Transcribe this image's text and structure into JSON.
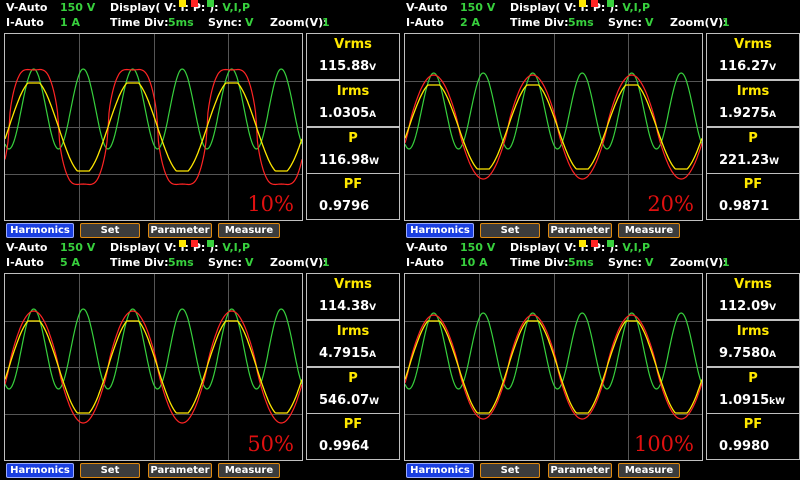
{
  "panels": [
    {
      "v_range_label": "V-Auto",
      "v_range_value": "150 V",
      "i_range_label": "I-Auto",
      "i_range_value": "1 A",
      "display_label": "Display( V:",
      "display_i": "I:",
      "display_p": "P:",
      "display_close": "):",
      "display_value": "V,I,P",
      "timediv_label": "Time  Div:",
      "timediv_value": "5ms",
      "sync_label": "Sync:",
      "sync_value": "V",
      "zoom_label": "Zoom(V):",
      "zoom_value": "1",
      "load_percent": "10%",
      "readings": [
        {
          "label": "Vrms",
          "value": "115.88",
          "unit": "V"
        },
        {
          "label": "Irms",
          "value": "1.0305",
          "unit": "A"
        },
        {
          "label": "P",
          "value": "116.98",
          "unit": "W"
        },
        {
          "label": "PF",
          "value": "0.9796",
          "unit": ""
        }
      ],
      "buttons": [
        "Harmonics",
        "Set",
        "Parameter",
        "Measure"
      ]
    },
    {
      "v_range_label": "V-Auto",
      "v_range_value": "150 V",
      "i_range_label": "I-Auto",
      "i_range_value": "2 A",
      "display_label": "Display( V:",
      "display_i": "I:",
      "display_p": "P:",
      "display_close": "):",
      "display_value": "V,I,P",
      "timediv_label": "Time  Div:",
      "timediv_value": "5ms",
      "sync_label": "Sync:",
      "sync_value": "V",
      "zoom_label": "Zoom(V):",
      "zoom_value": "1",
      "load_percent": "20%",
      "readings": [
        {
          "label": "Vrms",
          "value": "116.27",
          "unit": "V"
        },
        {
          "label": "Irms",
          "value": "1.9275",
          "unit": "A"
        },
        {
          "label": "P",
          "value": "221.23",
          "unit": "W"
        },
        {
          "label": "PF",
          "value": "0.9871",
          "unit": ""
        }
      ],
      "buttons": [
        "Harmonics",
        "Set",
        "Parameter",
        "Measure"
      ]
    },
    {
      "v_range_label": "V-Auto",
      "v_range_value": "150 V",
      "i_range_label": "I-Auto",
      "i_range_value": "5 A",
      "display_label": "Display( V:",
      "display_i": "I:",
      "display_p": "P:",
      "display_close": "):",
      "display_value": "V,I,P",
      "timediv_label": "Time  Div:",
      "timediv_value": "5ms",
      "sync_label": "Sync:",
      "sync_value": "V",
      "zoom_label": "Zoom(V):",
      "zoom_value": "1",
      "load_percent": "50%",
      "readings": [
        {
          "label": "Vrms",
          "value": "114.38",
          "unit": "V"
        },
        {
          "label": "Irms",
          "value": "4.7915",
          "unit": "A"
        },
        {
          "label": "P",
          "value": "546.07",
          "unit": "W"
        },
        {
          "label": "PF",
          "value": "0.9964",
          "unit": ""
        }
      ],
      "buttons": [
        "Harmonics",
        "Set",
        "Parameter",
        "Measure"
      ]
    },
    {
      "v_range_label": "V-Auto",
      "v_range_value": "150 V",
      "i_range_label": "I-Auto",
      "i_range_value": "10 A",
      "display_label": "Display( V:",
      "display_i": "I:",
      "display_p": "P:",
      "display_close": "):",
      "display_value": "V,I,P",
      "timediv_label": "Time  Div:",
      "timediv_value": "5ms",
      "sync_label": "Sync:",
      "sync_value": "V",
      "zoom_label": "Zoom(V):",
      "zoom_value": "1",
      "load_percent": "100%",
      "readings": [
        {
          "label": "Vrms",
          "value": "112.09",
          "unit": "V"
        },
        {
          "label": "Irms",
          "value": "9.7580",
          "unit": "A"
        },
        {
          "label": "P",
          "value": "1.0915",
          "unit": "kW"
        },
        {
          "label": "PF",
          "value": "0.9980",
          "unit": ""
        }
      ],
      "buttons": [
        "Harmonics",
        "Set",
        "Parameter",
        "Measure"
      ]
    }
  ],
  "colors": {
    "voltage_trace": "#ffe800",
    "current_trace": "#ff2424",
    "power_trace": "#37d03d",
    "grid": "#555555",
    "value_label": "#ffe800",
    "load_percent": "#e01010",
    "harmonics_button": "#1a3fe0",
    "button_border": "#e08a10"
  }
}
